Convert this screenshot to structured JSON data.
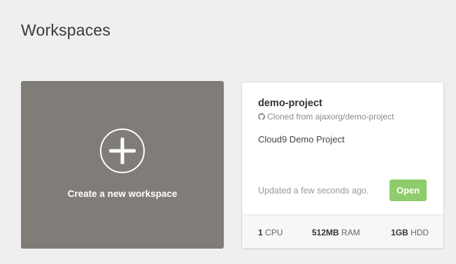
{
  "page": {
    "title": "Workspaces"
  },
  "create_tile": {
    "label": "Create a new workspace",
    "icon": "plus-icon"
  },
  "workspace": {
    "name": "demo-project",
    "source_icon": "github-icon",
    "source": "Cloned from ajaxorg/demo-project",
    "description": "Cloud9 Demo Project",
    "updated": "Updated a few seconds ago.",
    "open_label": "Open",
    "specs": {
      "cpu_value": "1",
      "cpu_unit": "CPU",
      "ram_value": "512MB",
      "ram_unit": "RAM",
      "hdd_value": "1GB",
      "hdd_unit": "HDD"
    }
  },
  "colors": {
    "background": "#efefef",
    "create_tile": "#807d78",
    "open_button": "#8fcc6b"
  }
}
